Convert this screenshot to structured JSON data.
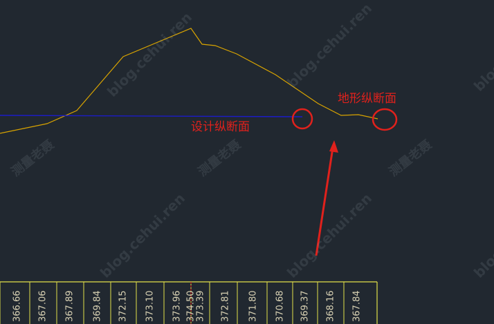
{
  "annotations": {
    "design_profile_label": "设计纵断面",
    "terrain_profile_label": "地形纵断面"
  },
  "watermarks": {
    "site": "blog.cehui.ren",
    "brand": "测量老聂"
  },
  "elevation_values": [
    "366.66",
    "367.06",
    "367.89",
    "369.84",
    "372.15",
    "373.10",
    "373.96",
    "374.50",
    "373.39",
    "372.81",
    "371.80",
    "370.68",
    "369.37",
    "368.16",
    "367.84"
  ],
  "colors": {
    "background": "#212830",
    "terrain_line": "#d9a400",
    "design_line": "#1c1cc8",
    "annotation_red": "#e0211c",
    "table_line": "#e2e24a",
    "value_text": "#d9d2b4",
    "station_marker": "#e0211c"
  }
}
